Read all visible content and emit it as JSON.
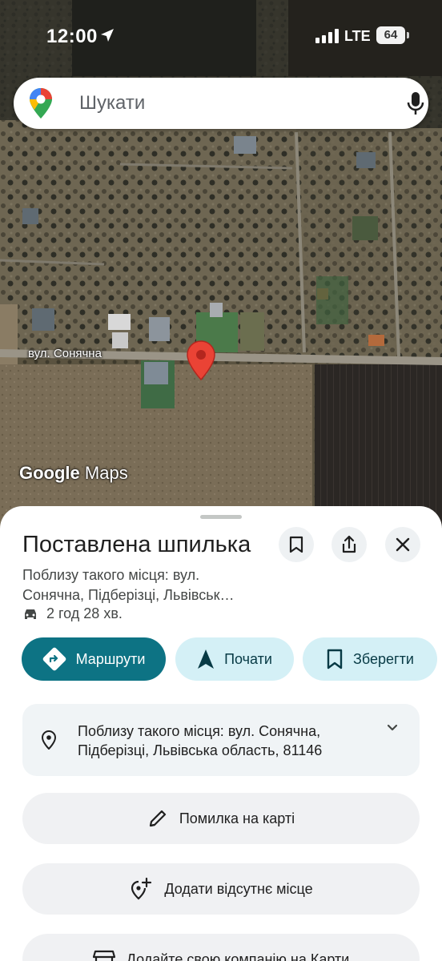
{
  "status_bar": {
    "time": "12:00",
    "network": "LTE",
    "battery": "64"
  },
  "search": {
    "placeholder": "Шукати"
  },
  "map": {
    "street_label": "вул. Сонячна",
    "attribution_google": "Google",
    "attribution_maps": "Maps"
  },
  "sheet": {
    "title": "Поставлена шпилька",
    "subtitle_line1": "Поблизу такого місця: вул.",
    "subtitle_line2": "Сонячна, Підберізці, Львівськ…",
    "drive_time": "2 год 28 хв.",
    "buttons": {
      "directions": "Маршрути",
      "start": "Почати",
      "save": "Зберегти"
    },
    "address_line1": "Поблизу такого місця: вул. Сонячна,",
    "address_line2": "Підберізці, Львівська область, 81146",
    "report_error": "Помилка на карті",
    "add_place": "Додати відсутнє місце",
    "add_business": "Додайте свою компанію на Карти"
  },
  "colors": {
    "primary": "#0d7384",
    "secondary": "#d4f0f6",
    "pin": "#ea4335"
  }
}
